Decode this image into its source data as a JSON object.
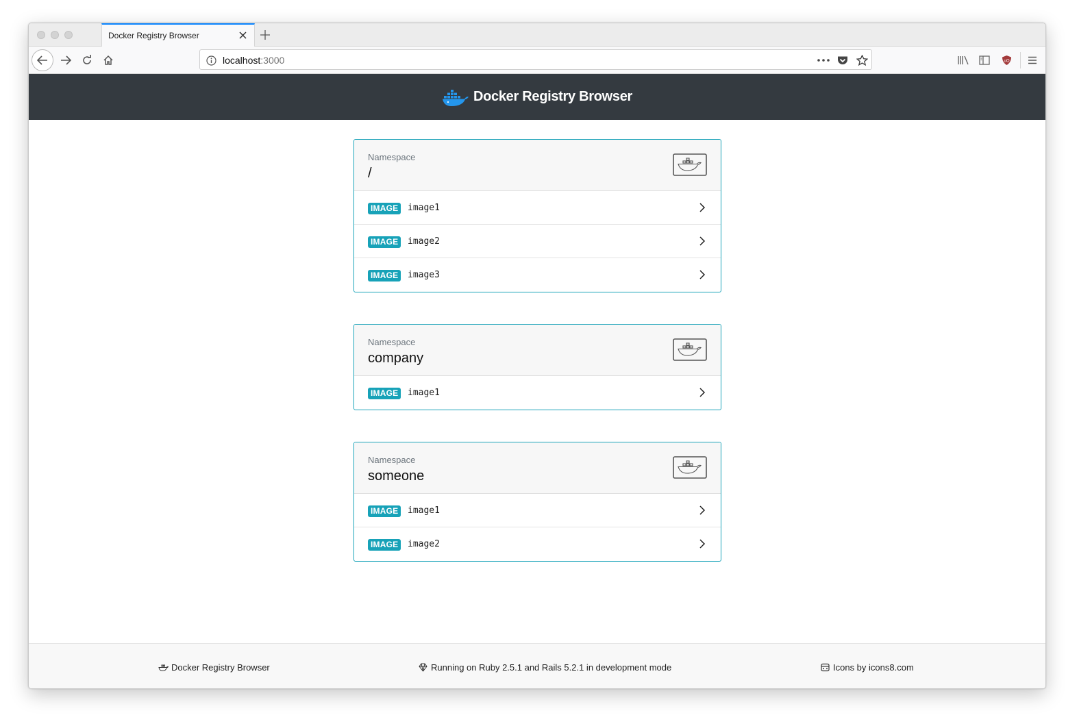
{
  "browser": {
    "tab_title": "Docker Registry Browser",
    "url_host": "localhost",
    "url_port": ":3000",
    "accent_color": "#0a84ff"
  },
  "header": {
    "brand_title": "Docker Registry Browser",
    "background_color": "#343a40"
  },
  "namespace_label": "Namespace",
  "image_badge": "IMAGE",
  "badge_color": "#17a2b8",
  "namespaces": [
    {
      "name": "/",
      "images": [
        "image1",
        "image2",
        "image3"
      ]
    },
    {
      "name": "company",
      "images": [
        "image1"
      ]
    },
    {
      "name": "someone",
      "images": [
        "image1",
        "image2"
      ]
    }
  ],
  "footer": {
    "left": "Docker Registry Browser",
    "center": "Running on Ruby 2.5.1 and Rails 5.2.1 in development mode",
    "right": "Icons by icons8.com"
  },
  "icons": {
    "brand": "docker-whale-icon",
    "namespace": "docker-namespace-icon",
    "row": "chevron-right-icon",
    "footer_left": "docker-whale-icon",
    "footer_center": "ruby-gem-icon",
    "footer_right": "icons8-logo-icon"
  }
}
